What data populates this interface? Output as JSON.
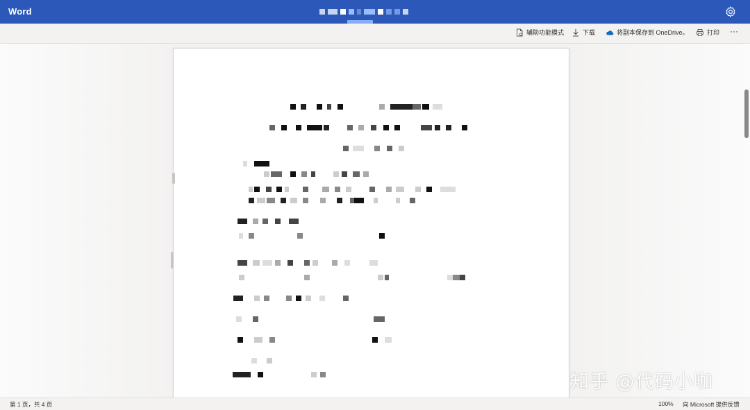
{
  "app": {
    "name": "Word"
  },
  "toolbar": {
    "accessibility_label": "辅助功能模式",
    "download_label": "下载",
    "save_copy_label": "将副本保存到 OneDrive。",
    "print_label": "打印",
    "more_label": "···"
  },
  "status": {
    "page_count": "第 1 页，共 4 页",
    "zoom": "100%",
    "feedback": "向 Microsoft 提供反馈"
  },
  "watermark": {
    "text": "知乎 @代码小咖"
  },
  "icons": {
    "settings": "gear-icon",
    "accessibility": "document-icon",
    "download": "download-arrow-icon",
    "onedrive": "cloud-icon",
    "print": "printer-icon",
    "more": "more-dots-icon"
  },
  "colors": {
    "title_bar": "#2b58b9",
    "onedrive_cloud": "#0f6cbd"
  }
}
